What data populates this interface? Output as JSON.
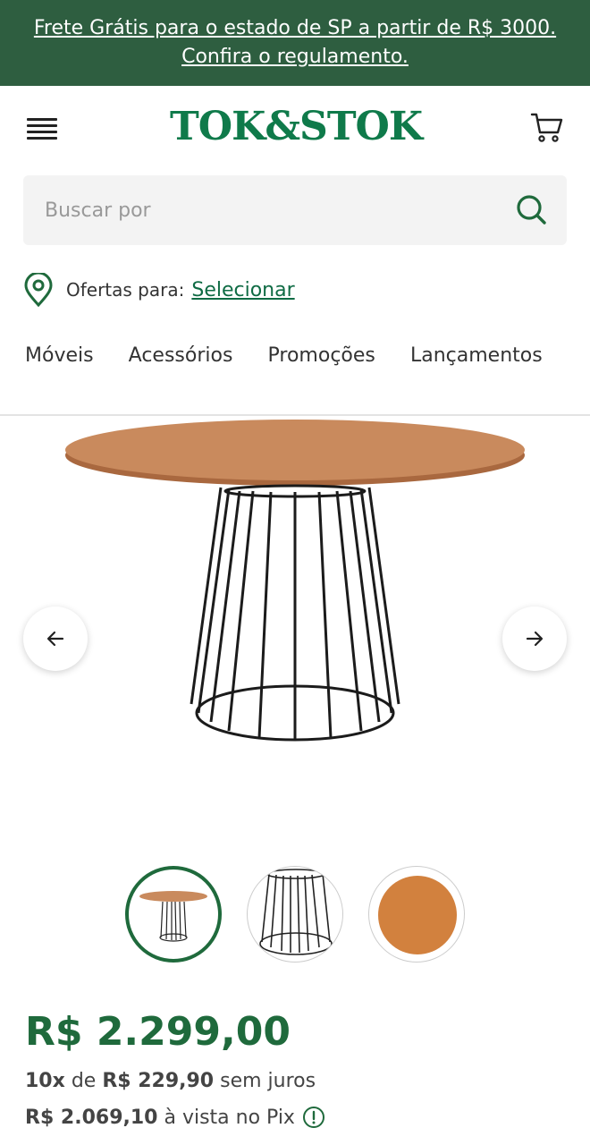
{
  "banner": {
    "line1": "Frete Grátis para o estado de SP a partir de R$ 3000.",
    "line2": "Confira o regulamento."
  },
  "header": {
    "logo_text": "TOK&STOK",
    "brand_color": "#0f7a4a"
  },
  "search": {
    "placeholder": "Buscar por"
  },
  "location": {
    "label": "Ofertas para:",
    "link": "Selecionar"
  },
  "nav": {
    "items": [
      "Móveis",
      "Acessórios",
      "Promoções",
      "Lançamentos"
    ]
  },
  "gallery": {
    "thumbnail_count": 3,
    "active_index": 0
  },
  "product": {
    "price": "R$ 2.299,00",
    "installments_count": "10x",
    "installments_de": "de",
    "installments_value": "R$ 229,90",
    "installments_suffix": "sem juros",
    "pix_value": "R$ 2.069,10",
    "pix_suffix": "à vista no Pix"
  },
  "colors": {
    "banner_bg": "#2e5e40",
    "price": "#1f6a3c",
    "link": "#0f6b44"
  }
}
